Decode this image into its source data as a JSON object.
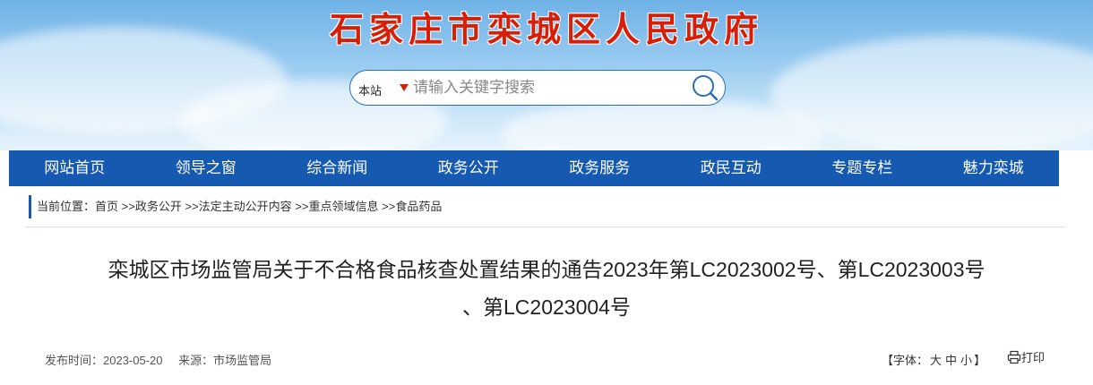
{
  "header": {
    "site_title": "石家庄市栾城区人民政府"
  },
  "search": {
    "scope_label": "本站",
    "placeholder": "请输入关键字搜索",
    "value": ""
  },
  "nav": {
    "items": [
      {
        "label": "网站首页"
      },
      {
        "label": "领导之窗"
      },
      {
        "label": "综合新闻"
      },
      {
        "label": "政务公开"
      },
      {
        "label": "政务服务"
      },
      {
        "label": "政民互动"
      },
      {
        "label": "专题专栏"
      },
      {
        "label": "魅力栾城"
      }
    ]
  },
  "breadcrumb": {
    "prefix": "当前位置：",
    "items": [
      "首页",
      "政务公开",
      "法定主动公开内容",
      "重点领域信息",
      "食品药品"
    ],
    "separator": ">>"
  },
  "article": {
    "title_line1": "栾城区市场监管局关于不合格食品核查处置结果的通告2023年第LC2023002号、第LC2023003号",
    "title_line2": "、第LC2023004号",
    "publish_label": "发布时间：2023-05-20",
    "source_label": "来源：市场监管局"
  },
  "tools": {
    "font_prefix": "【字体：",
    "font_large": "大",
    "font_medium": "中",
    "font_small": "小",
    "font_suffix": "】",
    "print_label": "打印"
  },
  "colors": {
    "brand_blue": "#1659b0",
    "title_red": "#d81e06"
  }
}
